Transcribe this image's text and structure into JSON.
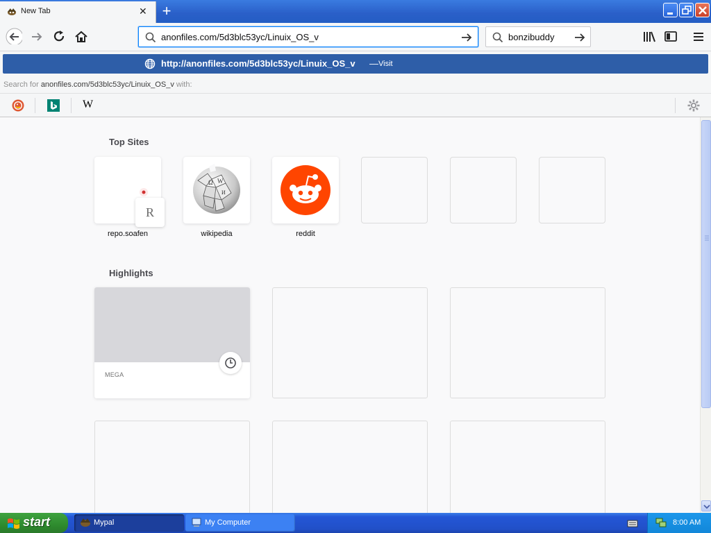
{
  "browser": {
    "tab": {
      "title": "New Tab"
    },
    "url_bar": {
      "value": "anonfiles.com/5d3blc53yc/Linuix_OS_v"
    },
    "search_bar": {
      "value": "bonzibuddy"
    }
  },
  "dropdown": {
    "visit_url": "http://anonfiles.com/5d3blc53yc/Linuix_OS_v",
    "visit_separator": "—",
    "visit_label": "Visit",
    "search_for_prefix": "Search for",
    "search_for_query": "anonfiles.com/5d3blc53yc/Linuix_OS_v",
    "search_for_suffix": "with:",
    "engines": [
      {
        "icon": "duckduckgo-icon"
      },
      {
        "icon": "bing-icon"
      },
      {
        "icon": "wikipedia-icon",
        "glyph": "W"
      }
    ]
  },
  "newtab": {
    "top_sites_title": "Top Sites",
    "top_sites": [
      {
        "label": "repo.soafen",
        "badge": "R"
      },
      {
        "label": "wikipedia"
      },
      {
        "label": "reddit"
      },
      {
        "label": ""
      },
      {
        "label": ""
      },
      {
        "label": ""
      }
    ],
    "highlights_title": "Highlights",
    "highlights": [
      {
        "source": "MEGA"
      },
      {
        "source": ""
      },
      {
        "source": ""
      },
      {
        "source": ""
      },
      {
        "source": ""
      },
      {
        "source": ""
      }
    ]
  },
  "taskbar": {
    "start_label": "start",
    "tasks": [
      {
        "label": "Mypal",
        "active": true
      },
      {
        "label": "My Computer",
        "active": false
      }
    ],
    "clock": "8:00 AM"
  },
  "colors": {
    "titlebar": "#2a5fc8",
    "visit_row": "#2e5ea8",
    "reddit": "#ff4500",
    "start_green": "#3fa33f"
  }
}
